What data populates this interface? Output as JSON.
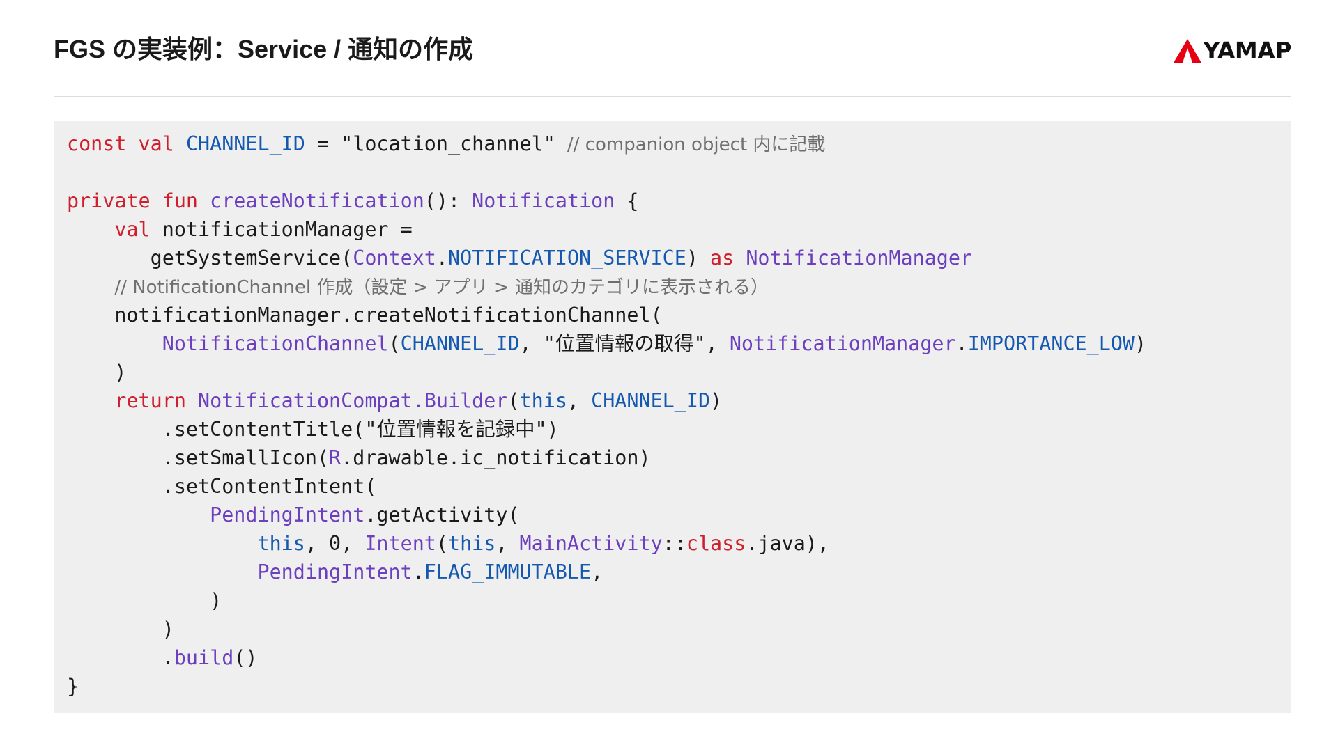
{
  "header": {
    "title": "FGS の実装例：Service / 通知の作成",
    "brand": "YAMAP"
  },
  "theme": {
    "keyword_color": "#cf1f2c",
    "type_color": "#6c3fbf",
    "constant_color": "#1558b0",
    "comment_color": "#6f6f6f",
    "code_background": "#efefef",
    "brand_color": "#e60012"
  },
  "code": {
    "language": "kotlin",
    "lines": [
      [
        {
          "t": "const val",
          "k": "kw"
        },
        {
          "t": " "
        },
        {
          "t": "CHANNEL_ID",
          "k": "id"
        },
        {
          "t": " = \"location_channel\" "
        },
        {
          "t": "// companion object 内に記載",
          "k": "cm"
        }
      ],
      [],
      [
        {
          "t": "private fun",
          "k": "kw"
        },
        {
          "t": " "
        },
        {
          "t": "createNotification",
          "k": "fn"
        },
        {
          "t": "(): "
        },
        {
          "t": "Notification",
          "k": "ty"
        },
        {
          "t": " {"
        }
      ],
      [
        {
          "t": "    "
        },
        {
          "t": "val",
          "k": "kw"
        },
        {
          "t": " notificationManager ="
        }
      ],
      [
        {
          "t": "       getSystemService("
        },
        {
          "t": "Context",
          "k": "ty"
        },
        {
          "t": "."
        },
        {
          "t": "NOTIFICATION_SERVICE",
          "k": "id"
        },
        {
          "t": ") "
        },
        {
          "t": "as",
          "k": "kw"
        },
        {
          "t": " "
        },
        {
          "t": "NotificationManager",
          "k": "ty"
        }
      ],
      [
        {
          "t": "    "
        },
        {
          "t": "// NotificationChannel 作成（設定 > アプリ > 通知のカテゴリに表示される）",
          "k": "cm"
        }
      ],
      [
        {
          "t": "    notificationManager.createNotificationChannel("
        }
      ],
      [
        {
          "t": "        "
        },
        {
          "t": "NotificationChannel",
          "k": "ty"
        },
        {
          "t": "("
        },
        {
          "t": "CHANNEL_ID",
          "k": "id"
        },
        {
          "t": ", \"位置情報の取得\", "
        },
        {
          "t": "NotificationManager",
          "k": "ty"
        },
        {
          "t": "."
        },
        {
          "t": "IMPORTANCE_LOW",
          "k": "id"
        },
        {
          "t": ")"
        }
      ],
      [
        {
          "t": "    )"
        }
      ],
      [
        {
          "t": "    "
        },
        {
          "t": "return",
          "k": "kw"
        },
        {
          "t": " "
        },
        {
          "t": "NotificationCompat.Builder",
          "k": "ty"
        },
        {
          "t": "("
        },
        {
          "t": "this",
          "k": "id"
        },
        {
          "t": ", "
        },
        {
          "t": "CHANNEL_ID",
          "k": "id"
        },
        {
          "t": ")"
        }
      ],
      [
        {
          "t": "        .setContentTitle(\"位置情報を記録中\")"
        }
      ],
      [
        {
          "t": "        .setSmallIcon("
        },
        {
          "t": "R",
          "k": "ty"
        },
        {
          "t": ".drawable.ic_notification)"
        }
      ],
      [
        {
          "t": "        .setContentIntent("
        }
      ],
      [
        {
          "t": "            "
        },
        {
          "t": "PendingIntent",
          "k": "ty"
        },
        {
          "t": ".getActivity("
        }
      ],
      [
        {
          "t": "                "
        },
        {
          "t": "this",
          "k": "id"
        },
        {
          "t": ", 0, "
        },
        {
          "t": "Intent",
          "k": "ty"
        },
        {
          "t": "("
        },
        {
          "t": "this",
          "k": "id"
        },
        {
          "t": ", "
        },
        {
          "t": "MainActivity",
          "k": "ty"
        },
        {
          "t": "::"
        },
        {
          "t": "class",
          "k": "kw"
        },
        {
          "t": ".java),"
        }
      ],
      [
        {
          "t": "                "
        },
        {
          "t": "PendingIntent",
          "k": "ty"
        },
        {
          "t": "."
        },
        {
          "t": "FLAG_IMMUTABLE",
          "k": "id"
        },
        {
          "t": ","
        }
      ],
      [
        {
          "t": "            )"
        }
      ],
      [
        {
          "t": "        )"
        }
      ],
      [
        {
          "t": "        ."
        },
        {
          "t": "build",
          "k": "fn"
        },
        {
          "t": "()"
        }
      ],
      [
        {
          "t": "}"
        }
      ]
    ]
  }
}
